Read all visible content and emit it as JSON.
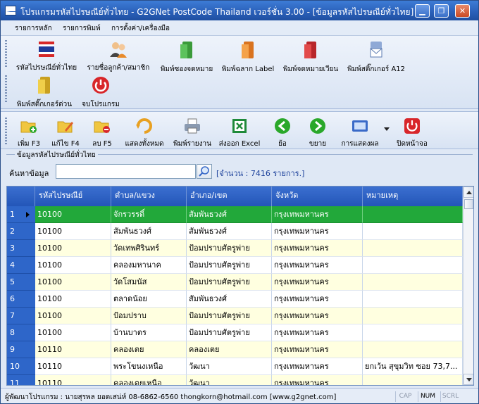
{
  "window": {
    "title": "โปรแกรมรหัสไปรษณีย์ทั่วไทย - G2GNet PostCode Thailand เวอร์ชั่น 3.00 - [ข้อมูลรหัสไปรษณีย์ทั่วไทย]",
    "minimize": "▁",
    "restore": "❐",
    "close": "✕"
  },
  "menu": [
    "รายการหลัก",
    "รายการพิมพ์",
    "การตั้งค่า/เครื่องมือ"
  ],
  "main_toolbar": [
    {
      "label": "รหัสไปรษณีย์ทั่วไทย",
      "icon": "thai-flag-icon"
    },
    {
      "label": "รายชื่อลูกค้า/สมาชิก",
      "icon": "members-icon"
    },
    {
      "label": "พิมพ์ซองจดหมาย",
      "icon": "green-folder-icon"
    },
    {
      "label": "พิมพ์ฉลาก Label",
      "icon": "orange-folder-icon"
    },
    {
      "label": "พิมพ์จดหมายเวียน",
      "icon": "red-folder-icon"
    },
    {
      "label": "พิมพ์สติ๊กเกอร์ A12",
      "icon": "mail-icon"
    },
    {
      "label": "พิมพ์สติ๊กเกอร์ด่วน",
      "icon": "yellow-folder-icon"
    },
    {
      "label": "จบโปรแกรม",
      "icon": "power-icon"
    }
  ],
  "sub_toolbar": [
    {
      "label": "เพิ่ม F3",
      "icon": "add-folder-icon"
    },
    {
      "label": "แก้ไข F4",
      "icon": "edit-folder-icon"
    },
    {
      "label": "ลบ F5",
      "icon": "delete-folder-icon"
    },
    {
      "label": "แสดงทั้งหมด",
      "icon": "refresh-icon"
    },
    {
      "label": "พิมพ์รายงาน",
      "icon": "printer-icon"
    },
    {
      "label": "ส่งออก Excel",
      "icon": "excel-icon"
    },
    {
      "label": "ย้อ",
      "icon": "back-arrow-icon"
    },
    {
      "label": "ขยาย",
      "icon": "forward-arrow-icon"
    },
    {
      "label": "การแสดงผล",
      "icon": "display-icon"
    },
    {
      "label": "ปิดหน้าจอ",
      "icon": "close-screen-icon"
    }
  ],
  "group_title": "ข้อมูลรหัสไปรษณีย์ทั่วไทย",
  "search": {
    "label": "ค้นหาข้อมูล",
    "value": "",
    "count_text": "[จำนวน : 7416 รายการ.]"
  },
  "table": {
    "columns": [
      "รหัสไปรษณีย์",
      "ตำบล/แขวง",
      "อำเภอ/เขต",
      "จังหวัด",
      "หมายเหตุ"
    ],
    "rows": [
      {
        "num": "1",
        "code": "10100",
        "subdistrict": "จักรวรรดิ์",
        "district": "สัมพันธวงศ์",
        "province": "กรุงเทพมหานคร",
        "note": ""
      },
      {
        "num": "2",
        "code": "10100",
        "subdistrict": "สัมพันธวงศ์",
        "district": "สัมพันธวงศ์",
        "province": "กรุงเทพมหานคร",
        "note": ""
      },
      {
        "num": "3",
        "code": "10100",
        "subdistrict": "วัดเทพศิรินทร์",
        "district": "ป้อมปราบศัตรูพ่าย",
        "province": "กรุงเทพมหานคร",
        "note": ""
      },
      {
        "num": "4",
        "code": "10100",
        "subdistrict": "คลองมหานาค",
        "district": "ป้อมปราบศัตรูพ่าย",
        "province": "กรุงเทพมหานคร",
        "note": ""
      },
      {
        "num": "5",
        "code": "10100",
        "subdistrict": "วัดโสมนัส",
        "district": "ป้อมปราบศัตรูพ่าย",
        "province": "กรุงเทพมหานคร",
        "note": ""
      },
      {
        "num": "6",
        "code": "10100",
        "subdistrict": "ตลาดน้อย",
        "district": "สัมพันธวงศ์",
        "province": "กรุงเทพมหานคร",
        "note": ""
      },
      {
        "num": "7",
        "code": "10100",
        "subdistrict": "ป้อมปราบ",
        "district": "ป้อมปราบศัตรูพ่าย",
        "province": "กรุงเทพมหานคร",
        "note": ""
      },
      {
        "num": "8",
        "code": "10100",
        "subdistrict": "บ้านบาตร",
        "district": "ป้อมปราบศัตรูพ่าย",
        "province": "กรุงเทพมหานคร",
        "note": ""
      },
      {
        "num": "9",
        "code": "10110",
        "subdistrict": "คลองเตย",
        "district": "คลองเตย",
        "province": "กรุงเทพมหานคร",
        "note": ""
      },
      {
        "num": "10",
        "code": "10110",
        "subdistrict": "พระโขนงเหนือ",
        "district": "วัฒนา",
        "province": "กรุงเทพมหานคร",
        "note": "ยกเว้น สุขุมวิท ซอย 73,7..."
      },
      {
        "num": "11",
        "code": "10110",
        "subdistrict": "คลองเตยเหนือ",
        "district": "วัฒนา",
        "province": "กรุงเทพมหานคร",
        "note": ""
      }
    ]
  },
  "status": {
    "text": "ผู้พัฒนาโปรแกรม : นายสุรพล ยอดเสน่ห์ 08-6862-6560 thongkorn@hotmail.com [www.g2gnet.com]",
    "keys": [
      "CAP",
      "NUM",
      "SCRL"
    ]
  },
  "colors": {
    "selected_row": "#22a83a",
    "header": "#2e66c9",
    "alt_row": "#ffffe0"
  }
}
